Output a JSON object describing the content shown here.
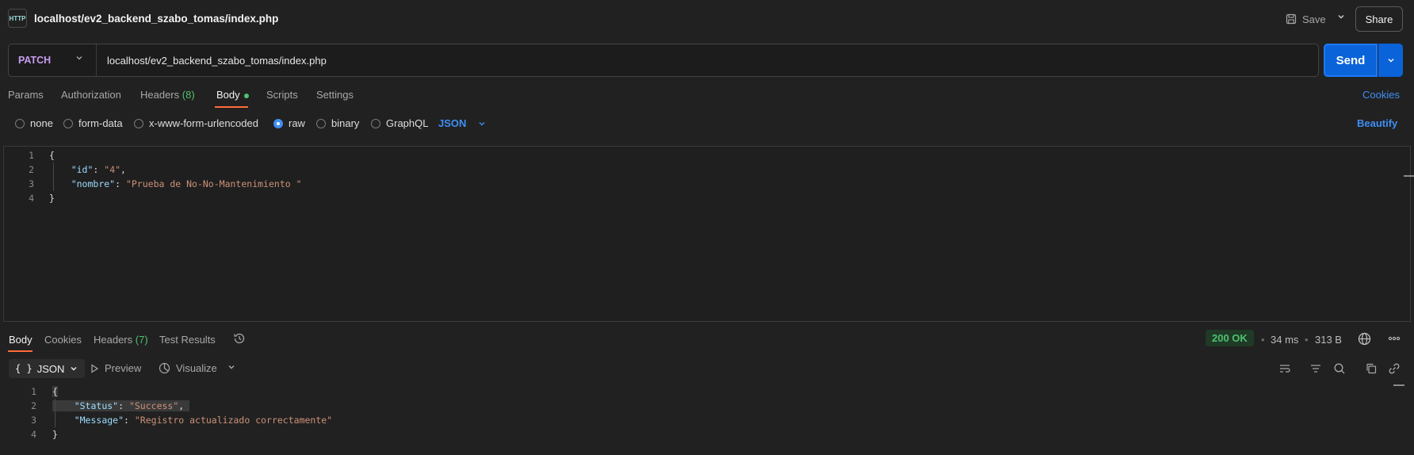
{
  "header": {
    "app_icon_text": "HTTP",
    "title": "localhost/ev2_backend_szabo_tomas/index.php",
    "save_label": "Save",
    "share_label": "Share"
  },
  "request": {
    "method": "PATCH",
    "url": "localhost/ev2_backend_szabo_tomas/index.php",
    "send_label": "Send"
  },
  "request_tabs": {
    "params": "Params",
    "authorization": "Authorization",
    "headers": "Headers",
    "headers_count": "(8)",
    "body": "Body",
    "scripts": "Scripts",
    "settings": "Settings",
    "cookies": "Cookies"
  },
  "body_types": {
    "none": "none",
    "form_data": "form-data",
    "urlencoded": "x-www-form-urlencoded",
    "raw": "raw",
    "binary": "binary",
    "graphql": "GraphQL",
    "selected_format": "JSON",
    "beautify": "Beautify"
  },
  "request_body": {
    "line_numbers": [
      "1",
      "2",
      "3",
      "4"
    ],
    "open_brace": "{",
    "id_key": "\"id\"",
    "id_value": "\"4\"",
    "nombre_key": "\"nombre\"",
    "nombre_value": "\"Prueba de No-No-Mantenimiento \"",
    "close_brace": "}"
  },
  "response_tabs": {
    "body": "Body",
    "cookies": "Cookies",
    "headers": "Headers",
    "headers_count": "(7)",
    "test_results": "Test Results"
  },
  "response_meta": {
    "status": "200 OK",
    "time": "34 ms",
    "size": "313 B"
  },
  "response_toolbar": {
    "format": "JSON",
    "preview": "Preview",
    "visualize": "Visualize"
  },
  "response_body": {
    "line_numbers": [
      "1",
      "2",
      "3",
      "4"
    ],
    "open_brace": "{",
    "status_key": "\"Status\"",
    "status_value": "\"Success\"",
    "message_key": "\"Message\"",
    "message_value": "\"Registro actualizado correctamente\"",
    "close_brace": "}"
  },
  "colors": {
    "accent_orange": "#ff6c37",
    "send_blue": "#0b63d9",
    "method_purple": "#c79cf0",
    "success_green": "#4fc26e"
  }
}
